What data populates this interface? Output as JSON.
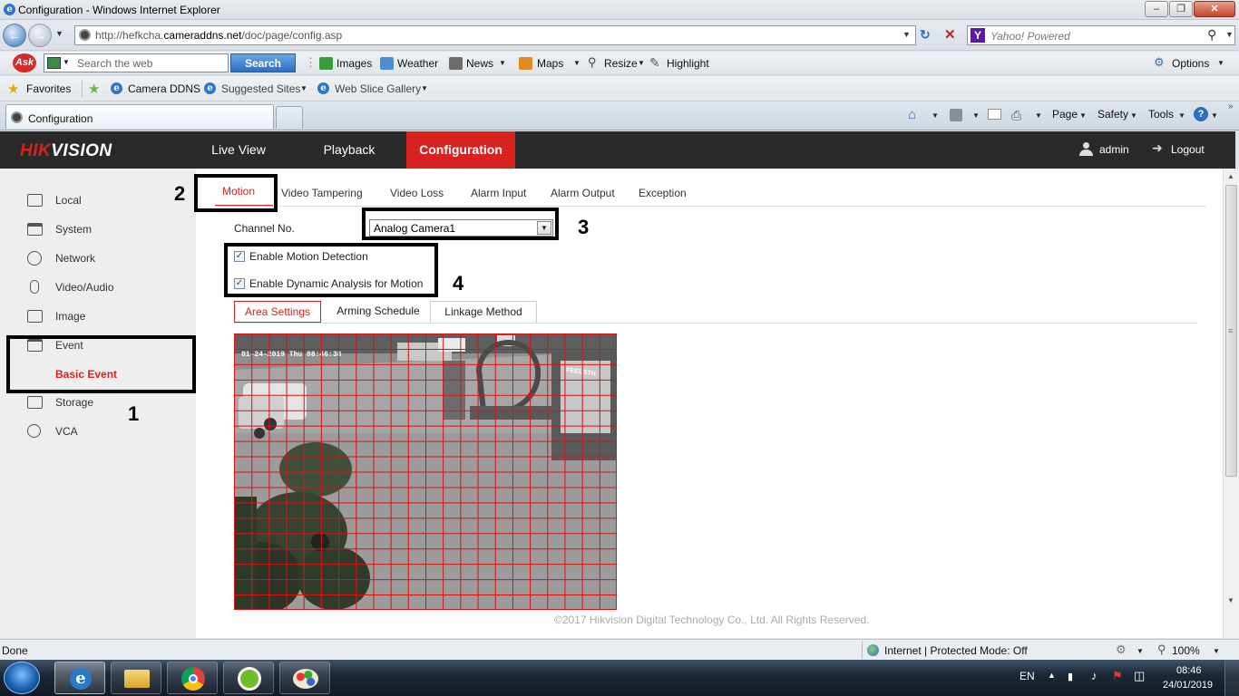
{
  "browser": {
    "title": "Configuration - Windows Internet Explorer",
    "url_prefix": "http://hefkcha.",
    "url_domain": "cameraddns.net",
    "url_suffix": "/doc/page/config.asp",
    "search_provider": "Yahoo! Powered",
    "ask_search_placeholder": "Search the web",
    "ask_search_button": "Search",
    "ask_items": [
      "Images",
      "Weather",
      "News",
      "Maps",
      "Resize",
      "Highlight"
    ],
    "options_label": "Options",
    "favorites_label": "Favorites",
    "fav_items": [
      "Camera DDNS",
      "Suggested Sites",
      "Web Slice Gallery"
    ],
    "tab_title": "Configuration",
    "cmd_items": [
      "Page",
      "Safety",
      "Tools"
    ]
  },
  "app": {
    "logo_red": "HIK",
    "logo_white": "VISION",
    "nav": [
      "Live View",
      "Playback",
      "Configuration"
    ],
    "active_nav": "Configuration",
    "user": "admin",
    "logout": "Logout",
    "accent_color": "#d8221f"
  },
  "sidebar": {
    "items": [
      "Local",
      "System",
      "Network",
      "Video/Audio",
      "Image",
      "Event",
      "Basic Event",
      "Storage",
      "VCA"
    ],
    "active_item": "Basic Event"
  },
  "event": {
    "tabs": [
      "Motion",
      "Video Tampering",
      "Video Loss",
      "Alarm Input",
      "Alarm Output",
      "Exception"
    ],
    "active_tab": "Motion",
    "channel_label": "Channel No.",
    "channel_value": "Analog Camera1",
    "enable_motion_label": "Enable Motion Detection",
    "enable_motion_checked": true,
    "enable_dynamic_label": "Enable Dynamic Analysis for Motion",
    "enable_dynamic_checked": true,
    "settings_tabs": [
      "Area Settings",
      "Arming Schedule",
      "Linkage Method"
    ],
    "active_settings_tab": "Area Settings",
    "camera_timestamp": "01-24-2019 Thu 08:46:38",
    "camera_sign": "FEEDSTH",
    "grid_color": "#e01010",
    "copyright": "©2017 Hikvision Digital Technology Co., Ltd. All Rights Reserved."
  },
  "annotations": [
    "1",
    "2",
    "3",
    "4"
  ],
  "status": {
    "left": "Done",
    "zone": "Internet | Protected Mode: Off",
    "zoom": "100%"
  },
  "taskbar": {
    "lang": "EN",
    "time": "08:46",
    "date": "24/01/2019"
  }
}
